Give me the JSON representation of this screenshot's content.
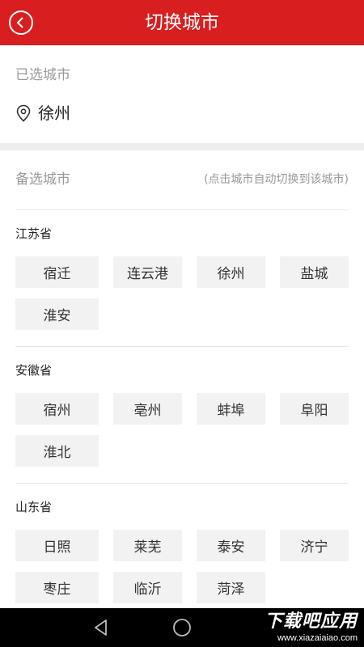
{
  "header": {
    "title": "切换城市"
  },
  "selected": {
    "label": "已选城市",
    "city": "徐州"
  },
  "candidates": {
    "label": "备选城市",
    "hint": "(点击城市自动切换到该城市)",
    "provinces": [
      {
        "name": "江苏省",
        "cities": [
          "宿迁",
          "连云港",
          "徐州",
          "盐城",
          "淮安"
        ]
      },
      {
        "name": "安徽省",
        "cities": [
          "宿州",
          "亳州",
          "蚌埠",
          "阜阳",
          "淮北"
        ]
      },
      {
        "name": "山东省",
        "cities": [
          "日照",
          "莱芜",
          "泰安",
          "济宁",
          "枣庄",
          "临沂",
          "菏泽"
        ]
      }
    ]
  },
  "watermark": {
    "main": "下载吧应用",
    "sub": "www.xiazaiaiao.com"
  }
}
